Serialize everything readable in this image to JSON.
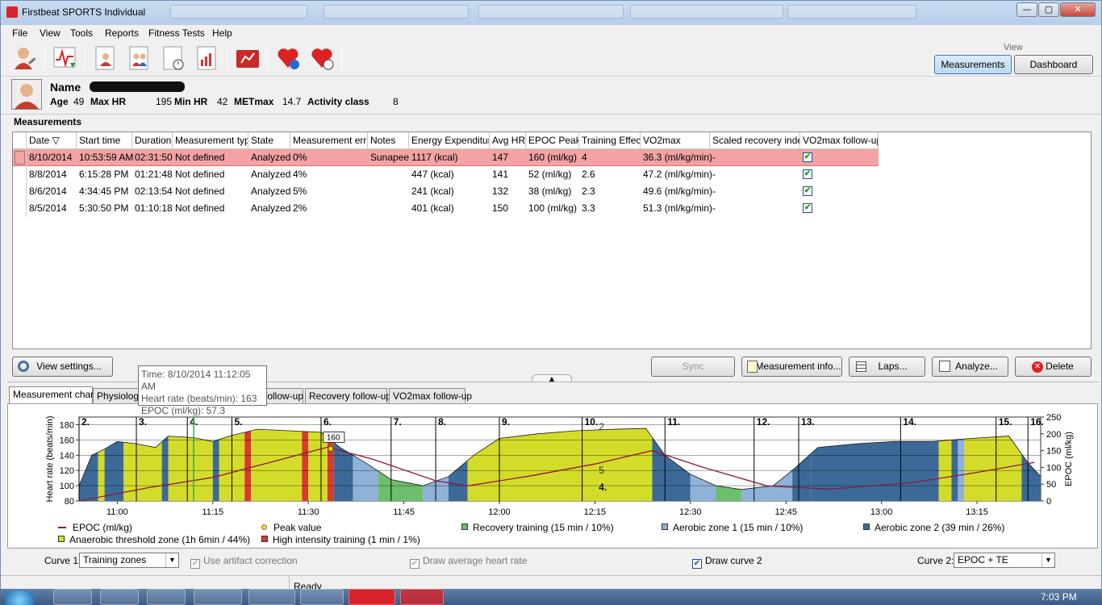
{
  "window": {
    "title": "Firstbeat SPORTS Individual",
    "min": "—",
    "max": "▢",
    "close": "✕"
  },
  "menu": [
    "File",
    "View",
    "Tools",
    "Reports",
    "Fitness Tests",
    "Help"
  ],
  "toolbar_icons": [
    "edit-person-icon",
    "heart-rate-download-icon",
    "report-person-icon",
    "report-group-icon",
    "report-time-icon",
    "report-chart-icon",
    "folder-graph-icon",
    "heart-wireless-icon",
    "heart-qrt-icon"
  ],
  "view": {
    "label": "View",
    "measurements": "Measurements",
    "dashboard": "Dashboard"
  },
  "person": {
    "name_label": "Name",
    "age_label": "Age",
    "age": "49",
    "maxhr_label": "Max HR",
    "maxhr": "195",
    "minhr_label": "Min HR",
    "minhr": "42",
    "metmax_label": "METmax",
    "metmax": "14.7",
    "activity_label": "Activity class",
    "activity": "8"
  },
  "measurements": {
    "title": "Measurements",
    "headers": [
      "Date ▽",
      "Start time",
      "Duration",
      "Measurement type",
      "State",
      "Measurement error",
      "Notes",
      "Energy Expenditure",
      "Avg HR",
      "EPOC Peak",
      "Training Effect",
      "VO2max",
      "Scaled recovery index",
      "VO2max follow-up"
    ],
    "rows": [
      [
        "8/10/2014",
        "10:53:59 AM",
        "02:31:50",
        "Not defined",
        "Analyzed",
        "0%",
        "Sunapee",
        "1117 (kcal)",
        "147",
        "160 (ml/kg)",
        "4",
        "36.3 (ml/kg/min)",
        "-",
        "✔"
      ],
      [
        "8/8/2014",
        "6:15:28 PM",
        "01:21:48",
        "Not defined",
        "Analyzed",
        "4%",
        "",
        "447 (kcal)",
        "141",
        "52 (ml/kg)",
        "2.6",
        "47.2 (ml/kg/min)",
        "-",
        "✔"
      ],
      [
        "8/6/2014",
        "4:34:45 PM",
        "02:13:54",
        "Not defined",
        "Analyzed",
        "5%",
        "",
        "241 (kcal)",
        "132",
        "38 (ml/kg)",
        "2.3",
        "49.6 (ml/kg/min)",
        "-",
        "✔"
      ],
      [
        "8/5/2014",
        "5:30:50 PM",
        "01:10:18",
        "Not defined",
        "Analyzed",
        "2%",
        "",
        "401 (kcal)",
        "150",
        "100 (ml/kg)",
        "3.3",
        "51.3 (ml/kg/min)",
        "-",
        "✔"
      ]
    ]
  },
  "buttons": {
    "view_settings": "View settings...",
    "sync": "Sync",
    "measurement_info": "Measurement info...",
    "laps": "Laps...",
    "analyze": "Analyze...",
    "delete": "Delete"
  },
  "tabs": [
    "Measurement chart",
    "Physiologic",
    "follow-up",
    "Recovery follow-up",
    "VO2max follow-up"
  ],
  "tooltip": {
    "time": "Time: 8/10/2014 11:12:05 AM",
    "hr": "Heart rate (beats/min): 163",
    "epoc": "EPOC (ml/kg): 57.3"
  },
  "chart_data": {
    "type": "area",
    "y_left_label": "Heart rate (beats/min)",
    "y_left_ticks": [
      "180",
      "160",
      "140",
      "120",
      "100",
      "80"
    ],
    "y_left_range": [
      80,
      190
    ],
    "y_right_label": "EPOC (ml/kg)",
    "y_right_ticks": [
      "250",
      "200",
      "150",
      "100",
      "50",
      "0"
    ],
    "y_right_range": [
      0,
      250
    ],
    "x_ticks": [
      "11:00",
      "11:15",
      "11:30",
      "11:45",
      "12:00",
      "12:15",
      "12:30",
      "12:45",
      "13:00",
      "13:15"
    ],
    "lap_markers": [
      "2.",
      "3.",
      "4.",
      "5.",
      "6.",
      "7.",
      "8.",
      "9.",
      "10.",
      "11.",
      "12.",
      "13.",
      "14.",
      "15.",
      "16."
    ],
    "peak_label": "160",
    "te_labels": [
      "2",
      "5",
      "4."
    ],
    "zone_colors": {
      "recovery": "#6cbf6c",
      "aerobic1": "#8fb2d8",
      "aerobic2": "#3c6a98",
      "anaerobic": "#d4dc2a",
      "high": "#d83a2c"
    },
    "epoc_color": "#8b1a3b",
    "hr_series": [
      {
        "t": "10:54",
        "hr": 100
      },
      {
        "t": "10:56",
        "hr": 140
      },
      {
        "t": "10:58",
        "hr": 148
      },
      {
        "t": "11:00",
        "hr": 158
      },
      {
        "t": "11:03",
        "hr": 155
      },
      {
        "t": "11:06",
        "hr": 150
      },
      {
        "t": "11:08",
        "hr": 165
      },
      {
        "t": "11:12",
        "hr": 163
      },
      {
        "t": "11:15",
        "hr": 158
      },
      {
        "t": "11:18",
        "hr": 166
      },
      {
        "t": "11:22",
        "hr": 174
      },
      {
        "t": "11:27",
        "hr": 172
      },
      {
        "t": "11:32",
        "hr": 170
      },
      {
        "t": "11:35",
        "hr": 150
      },
      {
        "t": "11:39",
        "hr": 130
      },
      {
        "t": "11:43",
        "hr": 108
      },
      {
        "t": "11:48",
        "hr": 100
      },
      {
        "t": "11:52",
        "hr": 112
      },
      {
        "t": "11:56",
        "hr": 140
      },
      {
        "t": "12:00",
        "hr": 162
      },
      {
        "t": "12:06",
        "hr": 168
      },
      {
        "t": "12:12",
        "hr": 172
      },
      {
        "t": "12:18",
        "hr": 174
      },
      {
        "t": "12:23",
        "hr": 175
      },
      {
        "t": "12:26",
        "hr": 140
      },
      {
        "t": "12:30",
        "hr": 115
      },
      {
        "t": "12:34",
        "hr": 100
      },
      {
        "t": "12:38",
        "hr": 95
      },
      {
        "t": "12:43",
        "hr": 100
      },
      {
        "t": "12:46",
        "hr": 120
      },
      {
        "t": "12:50",
        "hr": 150
      },
      {
        "t": "12:56",
        "hr": 155
      },
      {
        "t": "13:02",
        "hr": 158
      },
      {
        "t": "13:08",
        "hr": 158
      },
      {
        "t": "13:14",
        "hr": 162
      },
      {
        "t": "13:20",
        "hr": 165
      },
      {
        "t": "13:23",
        "hr": 130
      },
      {
        "t": "13:25",
        "hr": 112
      }
    ],
    "epoc_series": [
      {
        "t": "10:54",
        "epoc": 0
      },
      {
        "t": "11:05",
        "epoc": 40
      },
      {
        "t": "11:15",
        "epoc": 70
      },
      {
        "t": "11:25",
        "epoc": 120
      },
      {
        "t": "11:33",
        "epoc": 160
      },
      {
        "t": "11:40",
        "epoc": 125
      },
      {
        "t": "11:50",
        "epoc": 60
      },
      {
        "t": "11:55",
        "epoc": 45
      },
      {
        "t": "12:05",
        "epoc": 75
      },
      {
        "t": "12:15",
        "epoc": 110
      },
      {
        "t": "12:24",
        "epoc": 150
      },
      {
        "t": "12:32",
        "epoc": 100
      },
      {
        "t": "12:42",
        "epoc": 45
      },
      {
        "t": "12:52",
        "epoc": 35
      },
      {
        "t": "13:05",
        "epoc": 55
      },
      {
        "t": "13:15",
        "epoc": 85
      },
      {
        "t": "13:24",
        "epoc": 115
      }
    ],
    "legend": [
      {
        "key": "epoc",
        "label": "EPOC (ml/kg)"
      },
      {
        "key": "peak",
        "label": "Peak value"
      },
      {
        "key": "recovery",
        "label": "Recovery training (15 min / 10%)"
      },
      {
        "key": "aerobic1",
        "label": "Aerobic zone 1 (15 min / 10%)"
      },
      {
        "key": "aerobic2",
        "label": "Aerobic zone 2 (39 min / 26%)"
      },
      {
        "key": "anaerobic",
        "label": "Anaerobic threshold zone (1h 6min / 44%)"
      },
      {
        "key": "high",
        "label": "High intensity training (1 min / 1%)"
      }
    ]
  },
  "controls": {
    "curve1_label": "Curve 1:",
    "curve1_value": "Training zones",
    "artifact": "Use artifact correction",
    "avg_hr": "Draw average heart rate",
    "curve2_draw": "Draw curve 2",
    "curve2_label": "Curve 2:",
    "curve2_value": "EPOC + TE"
  },
  "status": "Ready",
  "clock": "7:03 PM"
}
